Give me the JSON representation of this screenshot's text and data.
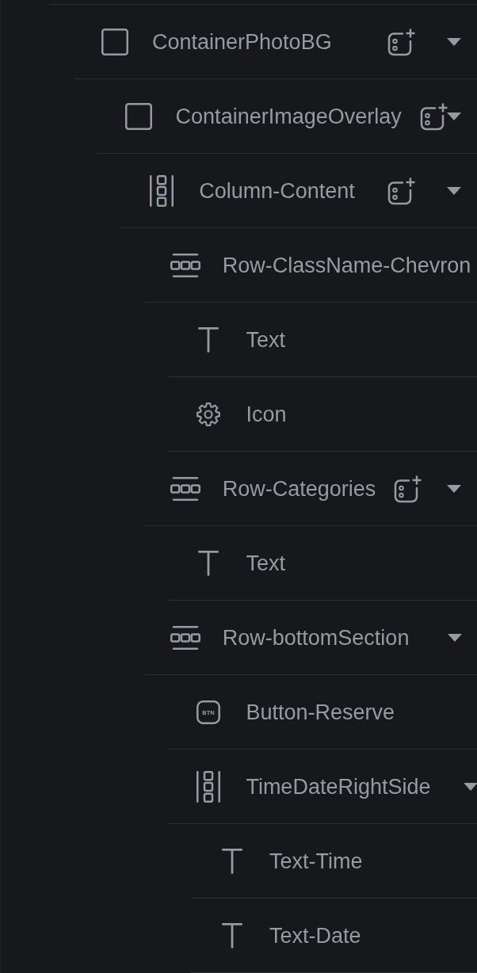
{
  "tree": [
    {
      "label": "ContainerPhotoBG",
      "kind": "container",
      "add_button": true,
      "expanded": true,
      "children": [
        {
          "label": "ContainerImageOverlay",
          "kind": "container",
          "add_button": true,
          "expanded": true,
          "children": [
            {
              "label": "Column-Content",
              "kind": "column",
              "add_button": true,
              "expanded": true,
              "children": [
                {
                  "label": "Row-ClassName-Chevron",
                  "kind": "row",
                  "children": [
                    {
                      "label": "Text",
                      "kind": "text"
                    },
                    {
                      "label": "Icon",
                      "kind": "icon"
                    }
                  ]
                },
                {
                  "label": "Row-Categories",
                  "kind": "row",
                  "add_button": true,
                  "expanded": true,
                  "children": [
                    {
                      "label": "Text",
                      "kind": "text"
                    }
                  ]
                },
                {
                  "label": "Row-bottomSection",
                  "kind": "row",
                  "expanded": true,
                  "children": [
                    {
                      "label": "Button-Reserve",
                      "kind": "button",
                      "icon_text": "BTN"
                    },
                    {
                      "label": "TimeDateRightSide",
                      "kind": "column",
                      "expanded": true,
                      "children": [
                        {
                          "label": "Text-Time",
                          "kind": "text"
                        },
                        {
                          "label": "Text-Date",
                          "kind": "text"
                        }
                      ]
                    }
                  ]
                }
              ]
            }
          ]
        }
      ]
    }
  ]
}
